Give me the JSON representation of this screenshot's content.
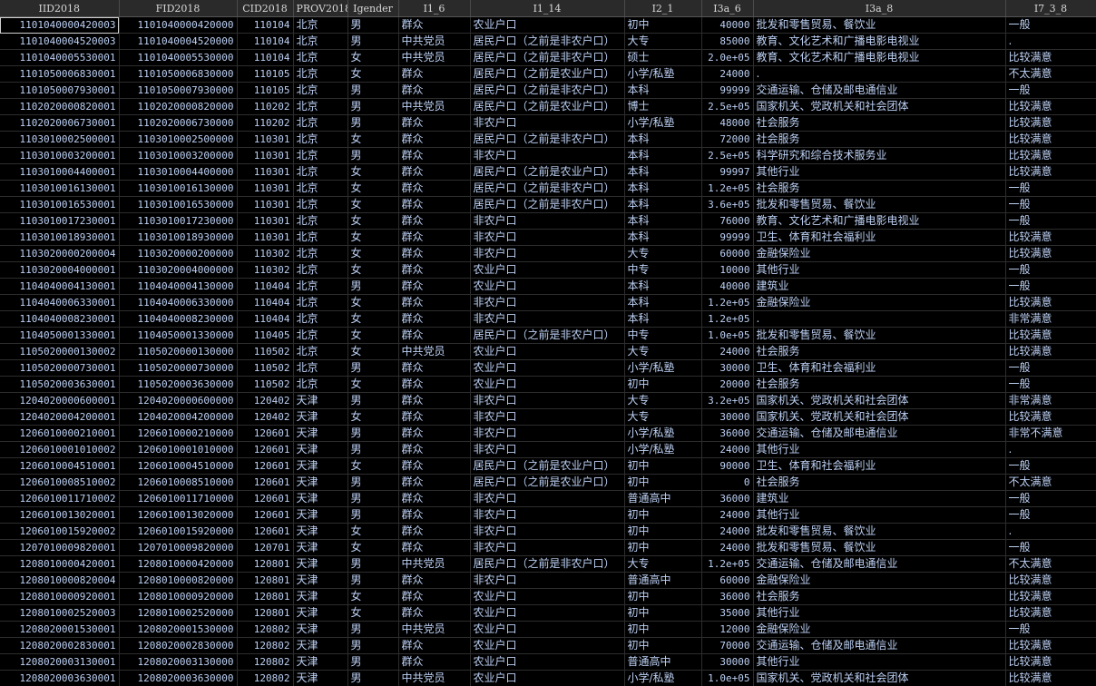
{
  "columns": [
    "IID2018",
    "FID2018",
    "CID2018",
    "PROV2018",
    "Igender",
    "I1_6",
    "I1_14",
    "I2_1",
    "I3a_6",
    "I3a_8",
    "I7_3_8"
  ],
  "column_align": [
    "num",
    "num",
    "num",
    "txt",
    "txt",
    "txt",
    "txt",
    "txt",
    "num",
    "txt",
    "txt"
  ],
  "rows": [
    [
      "110104000042000​3",
      "110104000042000​0",
      "110104",
      "北京",
      "男",
      "群众",
      "农业户口",
      "初中",
      "40000",
      "批发和零售贸易、餐饮业",
      "一般"
    ],
    [
      "1101040004520003",
      "110104000452000​0",
      "110104",
      "北京",
      "男",
      "中共党员",
      "居民户口（之前是非农户口）",
      "大专",
      "85000",
      "教育、文化艺术和广播电影电视业",
      "."
    ],
    [
      "1101040005530001",
      "1101040005530000",
      "110104",
      "北京",
      "女",
      "中共党员",
      "居民户口（之前是非农户口）",
      "硕士",
      "2.0e+05",
      "教育、文化艺术和广播电影电视业",
      "比较满意"
    ],
    [
      "1101050006830001",
      "1101050006830000",
      "110105",
      "北京",
      "女",
      "群众",
      "居民户口（之前是农业户口）",
      "小学/私塾",
      "24000",
      ".",
      "不太满意"
    ],
    [
      "1101050007930001",
      "1101050007930000",
      "110105",
      "北京",
      "男",
      "群众",
      "居民户口（之前是非农户口）",
      "本科",
      "99999",
      "交通运输、仓储及邮电通信业",
      "一般"
    ],
    [
      "1102020000820001",
      "1102020000820000",
      "110202",
      "北京",
      "男",
      "中共党员",
      "居民户口（之前是农业户口）",
      "博士",
      "2.5e+05",
      "国家机关、党政机关和社会团体",
      "比较满意"
    ],
    [
      "1102020006730001",
      "1102020006730000",
      "110202",
      "北京",
      "男",
      "群众",
      "非农户口",
      "小学/私塾",
      "48000",
      "社会服务",
      "比较满意"
    ],
    [
      "1103010002500001",
      "1103010002500000",
      "110301",
      "北京",
      "女",
      "群众",
      "居民户口（之前是非农户口）",
      "本科",
      "72000",
      "社会服务",
      "比较满意"
    ],
    [
      "1103010003200001",
      "1103010003200000",
      "110301",
      "北京",
      "男",
      "群众",
      "非农户口",
      "本科",
      "2.5e+05",
      "科学研究和综合技术服务业",
      "比较满意"
    ],
    [
      "1103010004400001",
      "1103010004400000",
      "110301",
      "北京",
      "女",
      "群众",
      "居民户口（之前是农业户口）",
      "本科",
      "99997",
      "其他行业",
      "比较满意"
    ],
    [
      "1103010016130001",
      "1103010016130000",
      "110301",
      "北京",
      "女",
      "群众",
      "居民户口（之前是非农户口）",
      "本科",
      "1.2e+05",
      "社会服务",
      "一般"
    ],
    [
      "1103010016530001",
      "1103010016530000",
      "110301",
      "北京",
      "女",
      "群众",
      "居民户口（之前是非农户口）",
      "本科",
      "3.6e+05",
      "批发和零售贸易、餐饮业",
      "一般"
    ],
    [
      "1103010017230001",
      "1103010017230000",
      "110301",
      "北京",
      "女",
      "群众",
      "非农户口",
      "本科",
      "76000",
      "教育、文化艺术和广播电影电视业",
      "一般"
    ],
    [
      "1103010018930001",
      "1103010018930000",
      "110301",
      "北京",
      "女",
      "群众",
      "非农户口",
      "本科",
      "99999",
      "卫生、体育和社会福利业",
      "比较满意"
    ],
    [
      "1103020000200004",
      "1103020000200000",
      "110302",
      "北京",
      "女",
      "群众",
      "非农户口",
      "大专",
      "60000",
      "金融保险业",
      "比较满意"
    ],
    [
      "1103020004000001",
      "1103020004000000",
      "110302",
      "北京",
      "女",
      "群众",
      "农业户口",
      "中专",
      "10000",
      "其他行业",
      "一般"
    ],
    [
      "1104040004130001",
      "1104040004130000",
      "110404",
      "北京",
      "男",
      "群众",
      "农业户口",
      "本科",
      "40000",
      "建筑业",
      "一般"
    ],
    [
      "1104040006330001",
      "1104040006330000",
      "110404",
      "北京",
      "女",
      "群众",
      "非农户口",
      "本科",
      "1.2e+05",
      "金融保险业",
      "比较满意"
    ],
    [
      "1104040008230001",
      "1104040008230000",
      "110404",
      "北京",
      "女",
      "群众",
      "非农户口",
      "本科",
      "1.2e+05",
      ".",
      "非常满意"
    ],
    [
      "1104050001330001",
      "1104050001330000",
      "110405",
      "北京",
      "女",
      "群众",
      "居民户口（之前是非农户口）",
      "中专",
      "1.0e+05",
      "批发和零售贸易、餐饮业",
      "比较满意"
    ],
    [
      "1105020000130002",
      "1105020000130000",
      "110502",
      "北京",
      "女",
      "中共党员",
      "农业户口",
      "大专",
      "24000",
      "社会服务",
      "比较满意"
    ],
    [
      "1105020000730001",
      "1105020000730000",
      "110502",
      "北京",
      "男",
      "群众",
      "农业户口",
      "小学/私塾",
      "30000",
      "卫生、体育和社会福利业",
      "一般"
    ],
    [
      "1105020003630001",
      "1105020003630000",
      "110502",
      "北京",
      "女",
      "群众",
      "农业户口",
      "初中",
      "20000",
      "社会服务",
      "一般"
    ],
    [
      "1204020000600001",
      "1204020000600000",
      "120402",
      "天津",
      "男",
      "群众",
      "非农户口",
      "大专",
      "3.2e+05",
      "国家机关、党政机关和社会团体",
      "非常满意"
    ],
    [
      "1204020004200001",
      "1204020004200000",
      "120402",
      "天津",
      "女",
      "群众",
      "非农户口",
      "大专",
      "30000",
      "国家机关、党政机关和社会团体",
      "比较满意"
    ],
    [
      "1206010000210001",
      "1206010000210000",
      "120601",
      "天津",
      "男",
      "群众",
      "非农户口",
      "小学/私塾",
      "36000",
      "交通运输、仓储及邮电通信业",
      "非常不满意"
    ],
    [
      "1206010001010002",
      "1206010001010000",
      "120601",
      "天津",
      "男",
      "群众",
      "非农户口",
      "小学/私塾",
      "24000",
      "其他行业",
      "."
    ],
    [
      "1206010004510001",
      "1206010004510000",
      "120601",
      "天津",
      "女",
      "群众",
      "居民户口（之前是农业户口）",
      "初中",
      "90000",
      "卫生、体育和社会福利业",
      "一般"
    ],
    [
      "1206010008510002",
      "1206010008510000",
      "120601",
      "天津",
      "男",
      "群众",
      "居民户口（之前是农业户口）",
      "初中",
      "0",
      "社会服务",
      "不太满意"
    ],
    [
      "1206010011710002",
      "1206010011710000",
      "120601",
      "天津",
      "男",
      "群众",
      "非农户口",
      "普通高中",
      "36000",
      "建筑业",
      "一般"
    ],
    [
      "1206010013020001",
      "1206010013020000",
      "120601",
      "天津",
      "男",
      "群众",
      "非农户口",
      "初中",
      "24000",
      "其他行业",
      "一般"
    ],
    [
      "1206010015920002",
      "1206010015920000",
      "120601",
      "天津",
      "女",
      "群众",
      "非农户口",
      "初中",
      "24000",
      "批发和零售贸易、餐饮业",
      "."
    ],
    [
      "1207010009820001",
      "1207010009820000",
      "120701",
      "天津",
      "女",
      "群众",
      "非农户口",
      "初中",
      "24000",
      "批发和零售贸易、餐饮业",
      "一般"
    ],
    [
      "1208010000420001",
      "1208010000420000",
      "120801",
      "天津",
      "男",
      "中共党员",
      "居民户口（之前是非农户口）",
      "大专",
      "1.2e+05",
      "交通运输、仓储及邮电通信业",
      "不太满意"
    ],
    [
      "1208010000820004",
      "1208010000820000",
      "120801",
      "天津",
      "男",
      "群众",
      "非农户口",
      "普通高中",
      "60000",
      "金融保险业",
      "比较满意"
    ],
    [
      "1208010000920001",
      "1208010000920000",
      "120801",
      "天津",
      "女",
      "群众",
      "农业户口",
      "初中",
      "36000",
      "社会服务",
      "比较满意"
    ],
    [
      "1208010002520003",
      "1208010002520000",
      "120801",
      "天津",
      "女",
      "群众",
      "农业户口",
      "初中",
      "35000",
      "其他行业",
      "比较满意"
    ],
    [
      "1208020001530001",
      "1208020001530000",
      "120802",
      "天津",
      "男",
      "中共党员",
      "农业户口",
      "初中",
      "12000",
      "金融保险业",
      "一般"
    ],
    [
      "1208020002830001",
      "1208020002830000",
      "120802",
      "天津",
      "男",
      "群众",
      "农业户口",
      "初中",
      "70000",
      "交通运输、仓储及邮电通信业",
      "比较满意"
    ],
    [
      "1208020003130001",
      "1208020003130000",
      "120802",
      "天津",
      "男",
      "群众",
      "农业户口",
      "普通高中",
      "30000",
      "其他行业",
      "比较满意"
    ],
    [
      "1208020003630001",
      "1208020003630000",
      "120802",
      "天津",
      "男",
      "中共党员",
      "农业户口",
      "小学/私塾",
      "1.0e+05",
      "国家机关、党政机关和社会团体",
      "比较满意"
    ]
  ]
}
